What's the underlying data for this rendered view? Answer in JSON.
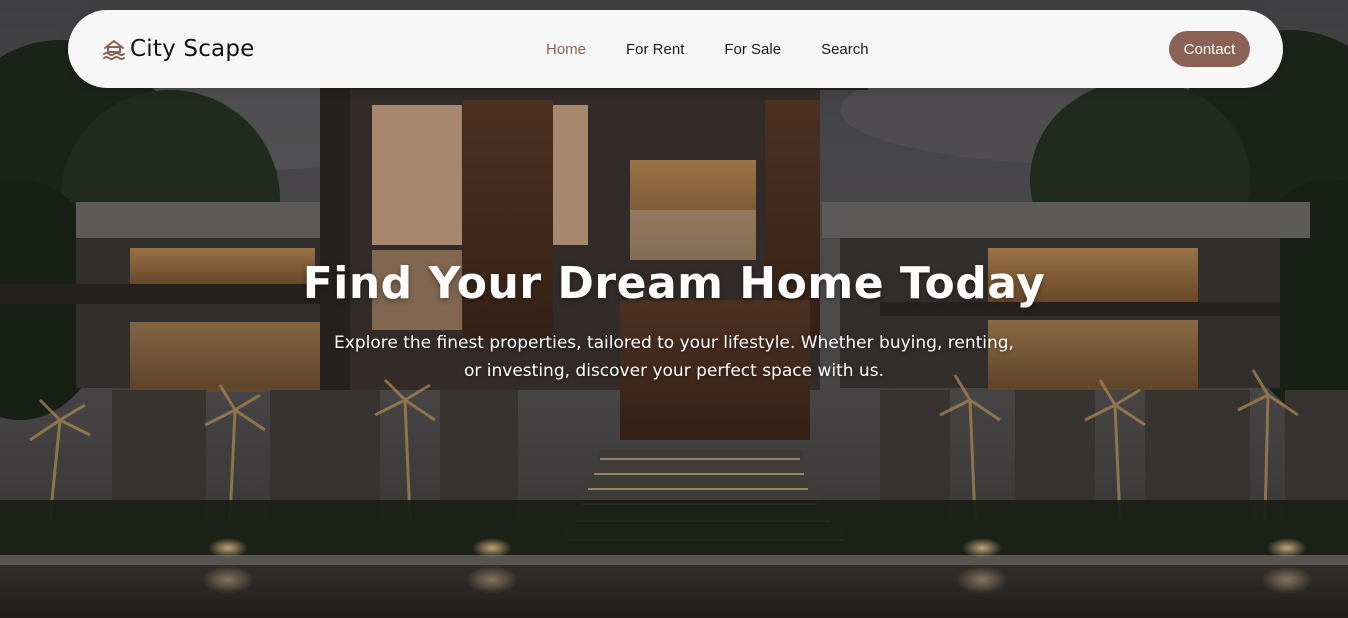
{
  "brand": {
    "name": "City Scape",
    "icon": "house-waves-icon"
  },
  "nav": {
    "links": [
      {
        "label": "Home",
        "active": true
      },
      {
        "label": "For Rent",
        "active": false
      },
      {
        "label": "For Sale",
        "active": false
      },
      {
        "label": "Search",
        "active": false
      }
    ],
    "contact_label": "Contact"
  },
  "hero": {
    "title": "Find Your Dream Home Today",
    "subtitle": "Explore the finest properties, tailored to your lifestyle. Whether buying, renting, or investing, discover your perfect space with us.",
    "background": "modern-house-at-dusk"
  },
  "colors": {
    "accent": "#8a6155",
    "navbar_bg": "#f7f7f7",
    "text_dark": "#1a1a1a",
    "hero_text": "#ffffff"
  }
}
